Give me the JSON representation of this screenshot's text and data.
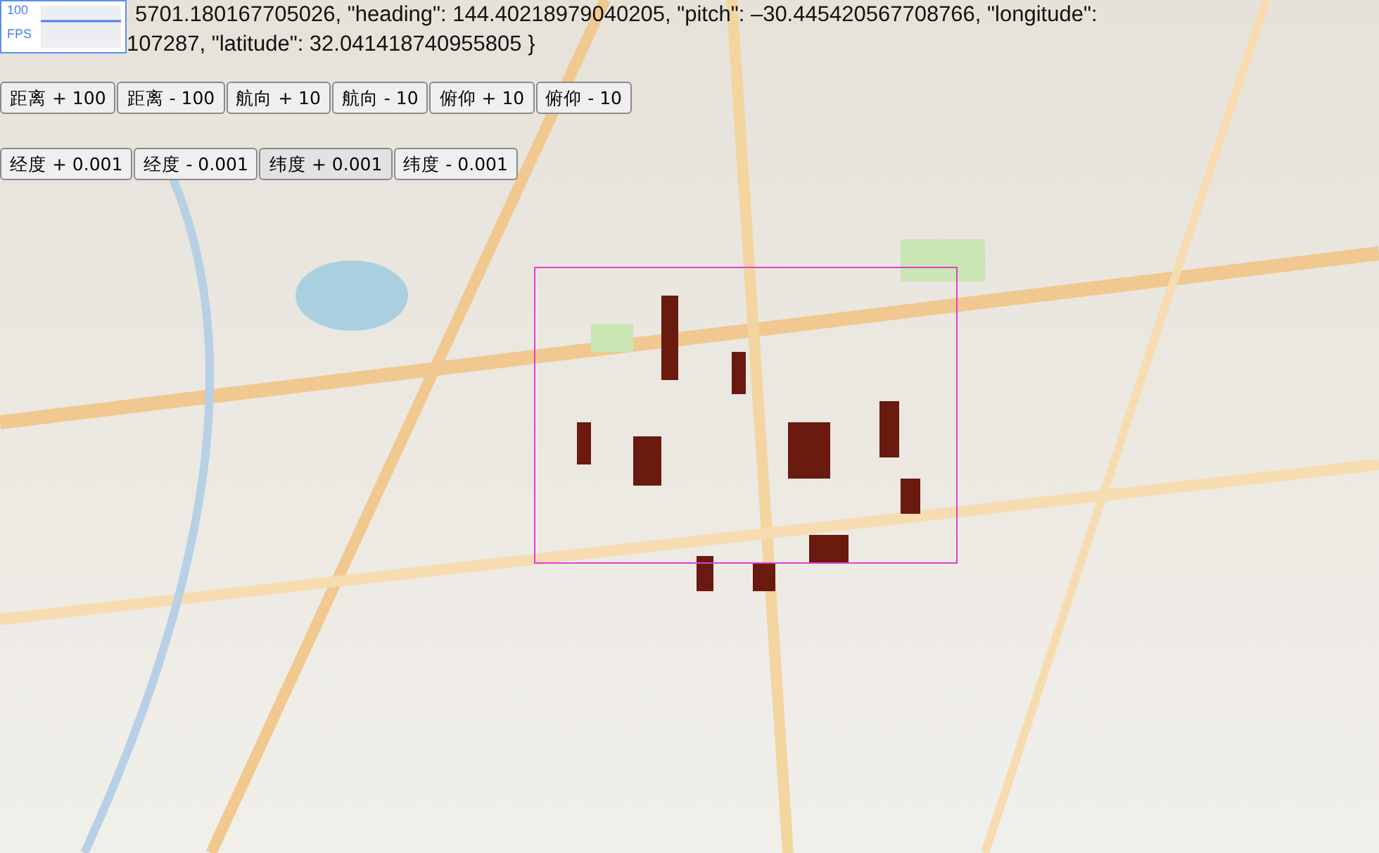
{
  "fps_panel": {
    "max_label": "100",
    "unit_label": "FPS"
  },
  "camera_info": [
    "5701.180167705026, \"heading\": 144.40218979040205, \"pitch\": –30.445420567708766, \"longitude\":",
    "107287, \"latitude\": 32.041418740955805 }"
  ],
  "button_rows": [
    [
      {
        "label": "距离 + 100",
        "hovered": false
      },
      {
        "label": "距离 - 100",
        "hovered": false
      },
      {
        "label": "航向 + 10",
        "hovered": false
      },
      {
        "label": "航向 - 10",
        "hovered": false
      },
      {
        "label": "俯仰 + 10",
        "hovered": false
      },
      {
        "label": "俯仰 - 10",
        "hovered": false
      }
    ],
    [
      {
        "label": "经度 + 0.001",
        "hovered": false
      },
      {
        "label": "经度 - 0.001",
        "hovered": false
      },
      {
        "label": "纬度 + 0.001",
        "hovered": true
      },
      {
        "label": "纬度 - 0.001",
        "hovered": false
      }
    ]
  ]
}
